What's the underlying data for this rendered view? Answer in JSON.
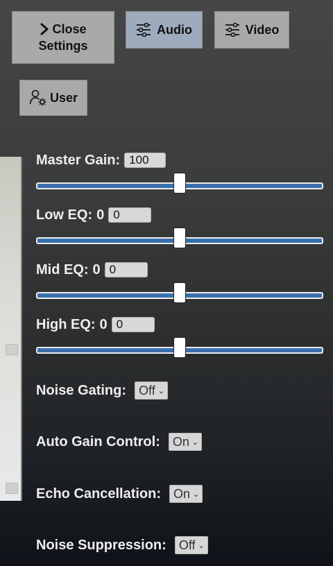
{
  "toolbar": {
    "close_line1": "Close",
    "close_line2": "Settings",
    "audio_label": "Audio",
    "video_label": "Video",
    "user_label": "User"
  },
  "audio": {
    "master_gain": {
      "label": "Master Gain:",
      "value_text": "",
      "input_value": "100",
      "slider_fraction": 0.5
    },
    "low_eq": {
      "label": "Low EQ:",
      "value_text": "0",
      "input_value": "0",
      "slider_fraction": 0.5
    },
    "mid_eq": {
      "label": "Mid EQ:",
      "value_text": "0",
      "input_value": "0",
      "slider_fraction": 0.5
    },
    "high_eq": {
      "label": "High EQ:",
      "value_text": "0",
      "input_value": "0",
      "slider_fraction": 0.5
    },
    "noise_gating": {
      "label": "Noise Gating:",
      "value": "Off"
    },
    "auto_gain": {
      "label": "Auto Gain Control:",
      "value": "On"
    },
    "echo_cancel": {
      "label": "Echo Cancellation:",
      "value": "On"
    },
    "noise_suppression": {
      "label": "Noise Suppression:",
      "value": "Off"
    }
  },
  "colors": {
    "active_tab": "#9eabbc",
    "slider_fill": "#3a6fae",
    "button": "#a9a9a9"
  }
}
